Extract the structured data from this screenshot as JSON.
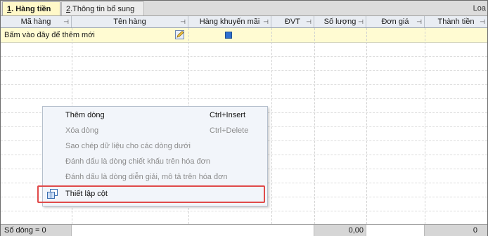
{
  "tabs": [
    {
      "number": "1",
      "rest": ". Hàng tiền"
    },
    {
      "number": "2",
      "rest": ".Thông tin bổ sung"
    }
  ],
  "tab_right_text": "Loa",
  "columns": [
    "Mã hàng",
    "Tên hàng",
    "Hàng khuyến mãi",
    "ĐVT",
    "Số lượng",
    "Đơn giá",
    "Thành tiền"
  ],
  "add_row": {
    "text": "Bấm vào đây để thêm mới",
    "promo_checked": true
  },
  "footer": {
    "row_count": "Số dòng = 0",
    "quantity_total": "0,00",
    "amount_total": "0"
  },
  "context_menu": {
    "items": [
      {
        "label": "Thêm dòng",
        "shortcut": "Ctrl+Insert",
        "enabled": true
      },
      {
        "label": "Xóa dòng",
        "shortcut": "Ctrl+Delete",
        "enabled": false
      },
      {
        "label": "Sao chép dữ liệu cho các dòng dưới",
        "shortcut": "",
        "enabled": false
      },
      {
        "label": "Đánh dấu là dòng chiết khấu trên hóa đơn",
        "shortcut": "",
        "enabled": false
      },
      {
        "label": "Đánh dấu là dòng diễn giải, mô tả trên hóa đơn",
        "shortcut": "",
        "enabled": false
      },
      {
        "label": "Thiết lập cột",
        "shortcut": "",
        "enabled": true,
        "icon": "columns-settings-icon"
      }
    ]
  },
  "colors": {
    "active_tab": "#fff8c8",
    "add_row": "#fffbd2",
    "highlight_border": "#e04a4a",
    "checkbox": "#2f6fd0"
  }
}
